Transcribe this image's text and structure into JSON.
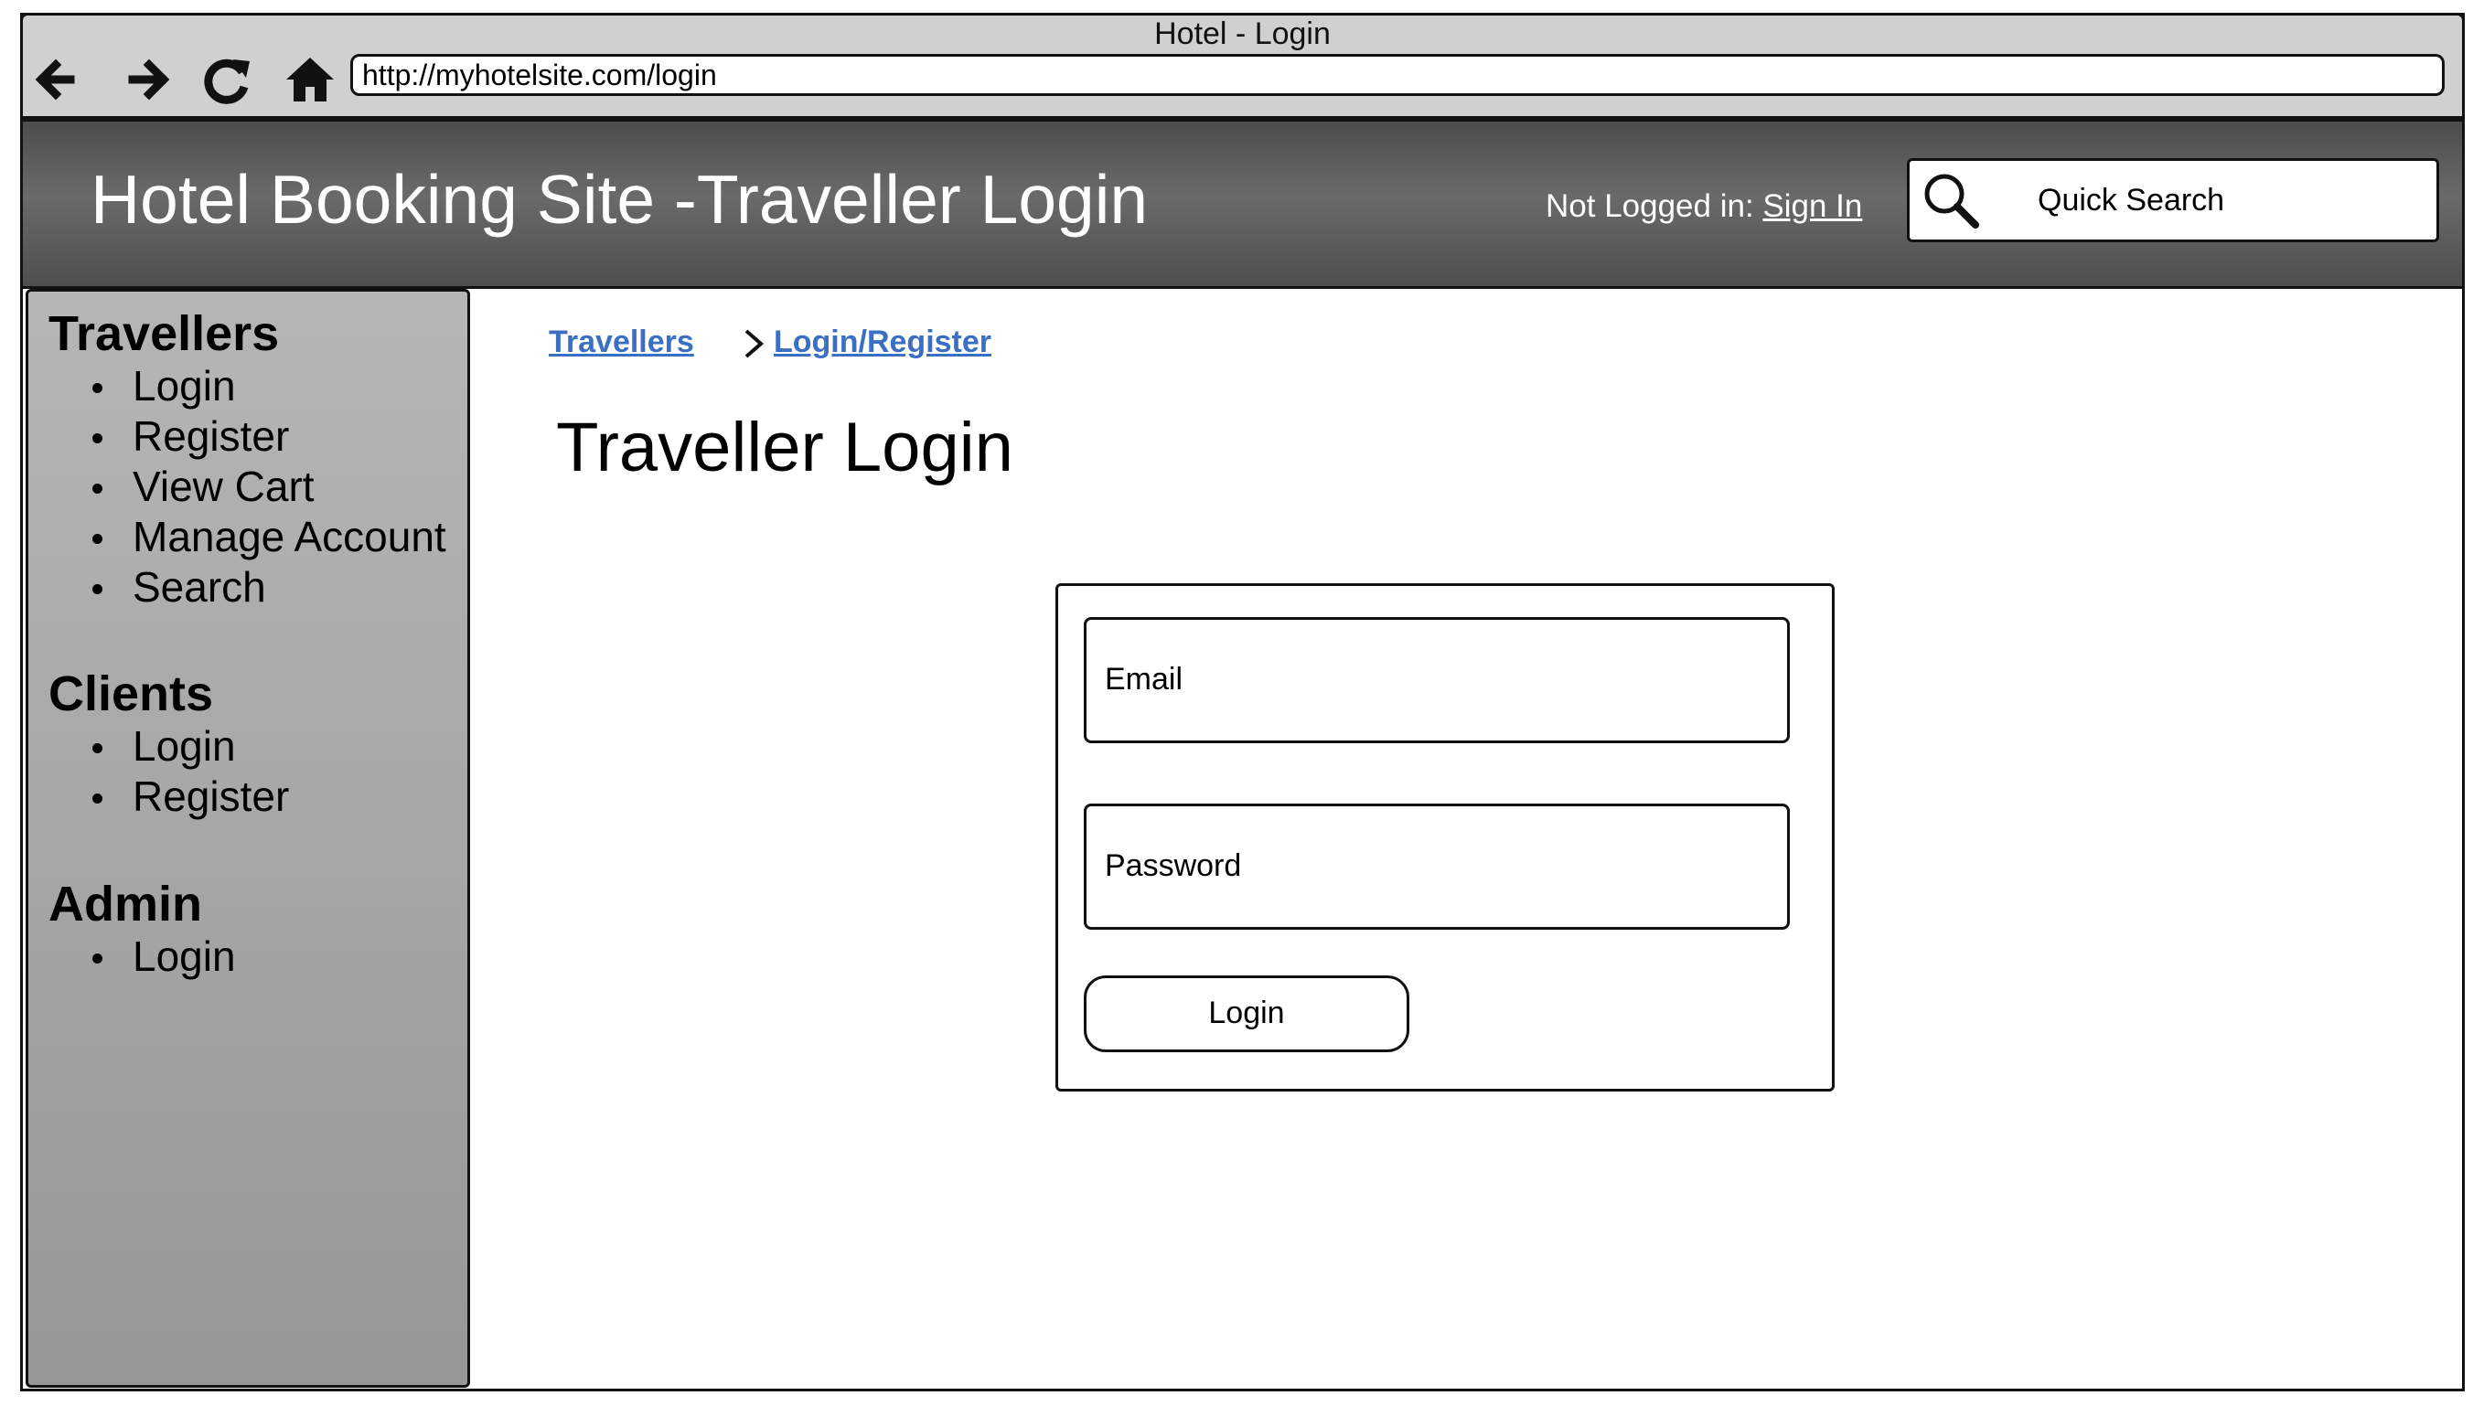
{
  "browser": {
    "window_title": "Hotel - Login",
    "url": "http://myhotelsite.com/login",
    "nav_icons": [
      "back-arrow-icon",
      "forward-arrow-icon",
      "reload-icon",
      "home-icon"
    ]
  },
  "header": {
    "title": "Hotel Booking Site -Traveller Login",
    "status_prefix": "Not Logged in: ",
    "sign_in_label": "Sign In",
    "quick_search_label": "Quick Search",
    "background_color": "#5a5a5a"
  },
  "sidebar": {
    "sections": [
      {
        "title": "Travellers",
        "items": [
          "Login",
          "Register",
          "View Cart",
          "Manage Account",
          "Search"
        ]
      },
      {
        "title": "Clients",
        "items": [
          "Login",
          "Register"
        ]
      },
      {
        "title": "Admin",
        "items": [
          "Login"
        ]
      }
    ]
  },
  "breadcrumb": {
    "items": [
      "Travellers",
      "Login/Register"
    ],
    "link_color": "#3a6fc4"
  },
  "main": {
    "page_title": "Traveller Login",
    "form": {
      "email_placeholder": "Email",
      "password_placeholder": "Password",
      "login_button": "Login"
    }
  }
}
